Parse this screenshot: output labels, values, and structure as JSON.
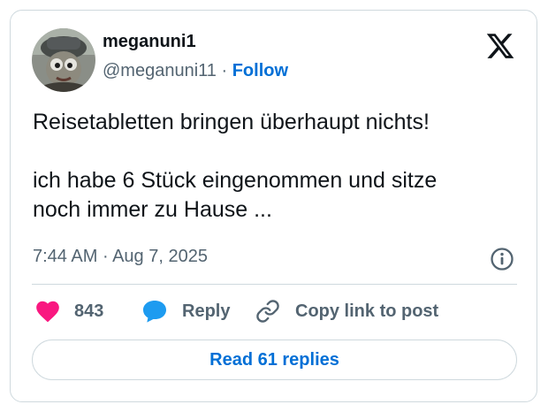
{
  "author": {
    "display_name": "meganuni1",
    "handle": "@meganuni11",
    "separator": "·",
    "follow_label": "Follow"
  },
  "tweet": {
    "text": "Reisetabletten bringen überhaupt nichts!\n\nich habe 6 Stück eingenommen und sitze\nnoch immer zu Hause ...",
    "time": "7:44 AM",
    "separator": "·",
    "date": "Aug 7, 2025"
  },
  "actions": {
    "like_count": "843",
    "reply_label": "Reply",
    "copy_link_label": "Copy link to post"
  },
  "footer": {
    "read_replies_label": "Read 61 replies"
  },
  "icons": {
    "logo": "x-logo-icon",
    "info": "info-icon",
    "like": "heart-icon",
    "reply": "speech-bubble-icon",
    "copy": "link-icon"
  },
  "colors": {
    "like": "#f91880",
    "reply": "#1d9bf0",
    "link": "#006fd6",
    "muted": "#536471",
    "border": "#cfd9de"
  }
}
